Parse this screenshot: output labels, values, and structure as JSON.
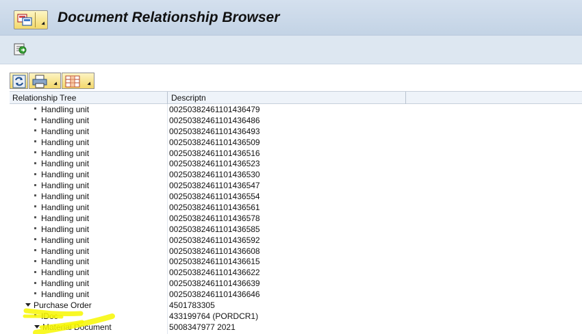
{
  "window": {
    "title": "Document Relationship Browser"
  },
  "grid": {
    "columns": [
      "Relationship Tree",
      "Descriptn"
    ],
    "rows": [
      {
        "node": "Handling unit",
        "desc": "00250382461101436479",
        "kind": "leaf"
      },
      {
        "node": "Handling unit",
        "desc": "00250382461101436486",
        "kind": "leaf"
      },
      {
        "node": "Handling unit",
        "desc": "00250382461101436493",
        "kind": "leaf"
      },
      {
        "node": "Handling unit",
        "desc": "00250382461101436509",
        "kind": "leaf"
      },
      {
        "node": "Handling unit",
        "desc": "00250382461101436516",
        "kind": "leaf"
      },
      {
        "node": "Handling unit",
        "desc": "00250382461101436523",
        "kind": "leaf"
      },
      {
        "node": "Handling unit",
        "desc": "00250382461101436530",
        "kind": "leaf"
      },
      {
        "node": "Handling unit",
        "desc": "00250382461101436547",
        "kind": "leaf"
      },
      {
        "node": "Handling unit",
        "desc": "00250382461101436554",
        "kind": "leaf"
      },
      {
        "node": "Handling unit",
        "desc": "00250382461101436561",
        "kind": "leaf"
      },
      {
        "node": "Handling unit",
        "desc": "00250382461101436578",
        "kind": "leaf"
      },
      {
        "node": "Handling unit",
        "desc": "00250382461101436585",
        "kind": "leaf"
      },
      {
        "node": "Handling unit",
        "desc": "00250382461101436592",
        "kind": "leaf"
      },
      {
        "node": "Handling unit",
        "desc": "00250382461101436608",
        "kind": "leaf"
      },
      {
        "node": "Handling unit",
        "desc": "00250382461101436615",
        "kind": "leaf"
      },
      {
        "node": "Handling unit",
        "desc": "00250382461101436622",
        "kind": "leaf"
      },
      {
        "node": "Handling unit",
        "desc": "00250382461101436639",
        "kind": "leaf"
      },
      {
        "node": "Handling unit",
        "desc": "00250382461101436646",
        "kind": "leaf"
      },
      {
        "node": "Purchase Order",
        "desc": "4501783305",
        "kind": "expanded-root"
      },
      {
        "node": "IDoc",
        "desc": "433199764 (PORDCR1)",
        "kind": "leaf"
      },
      {
        "node": "Material Document",
        "desc": "5008347977 2021",
        "kind": "expanded"
      }
    ]
  },
  "icons": {
    "menu": "sap-menu-icon",
    "app_toolbar": "display-object-icon",
    "grid_toolbar": [
      "refresh-icon",
      "print-icon",
      "layout-icon"
    ]
  },
  "colors": {
    "title_bar": "#c3d3e5",
    "highlight": "#f7f700"
  }
}
